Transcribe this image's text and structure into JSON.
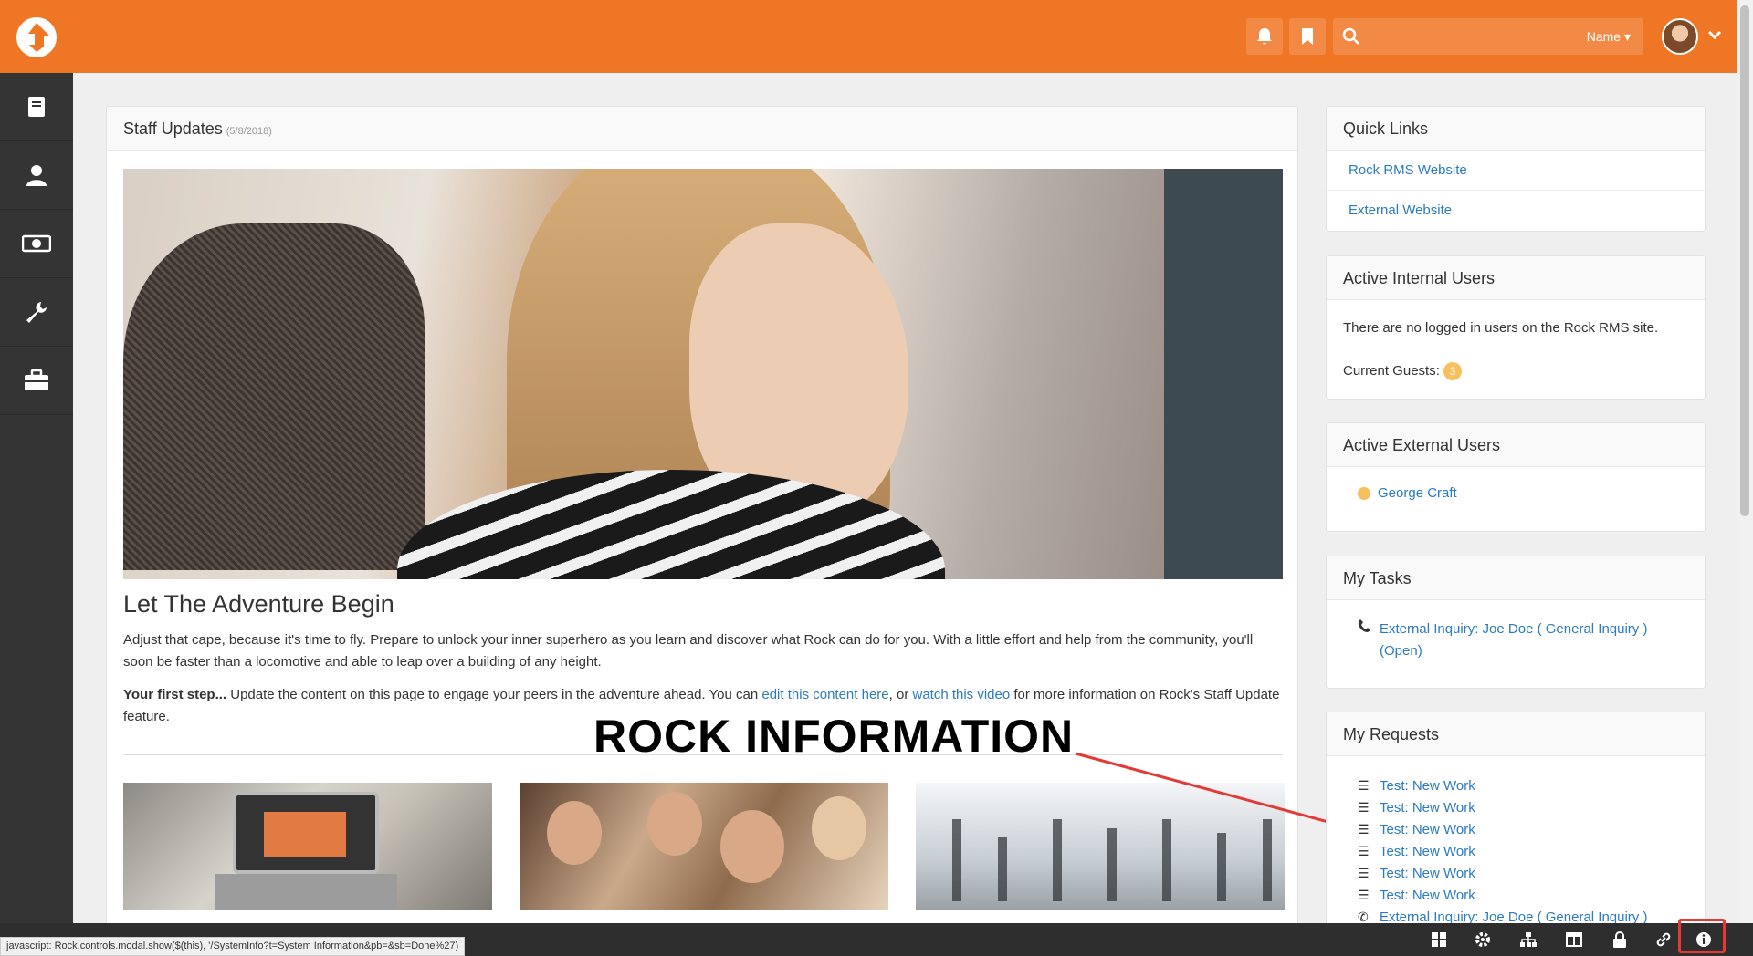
{
  "topbar": {
    "search_placeholder": "",
    "search_scope": "Name"
  },
  "main": {
    "panel_title": "Staff Updates",
    "panel_date": "(5/8/2018)",
    "headline": "Let The Adventure Begin",
    "intro": "Adjust that cape, because it's time to fly. Prepare to unlock your inner superhero as you learn and discover what Rock can do for you. With a little effort and help from the community, you'll soon be faster than a locomotive and able to leap over a building of any height.",
    "first_step_label": "Your first step...",
    "first_step_text1": " Update the content on this page to engage your peers in the adventure ahead. You can ",
    "first_step_link1": "edit this content here",
    "first_step_text2": ", or ",
    "first_step_link2": "watch this video",
    "first_step_text3": " for more information on Rock's Staff Update feature."
  },
  "annotation": "ROCK INFORMATION",
  "quick_links": {
    "title": "Quick Links",
    "items": [
      "Rock RMS Website",
      "External Website"
    ]
  },
  "internal_users": {
    "title": "Active Internal Users",
    "message": "There are no logged in users on the Rock RMS site.",
    "guests_label": "Current Guests:",
    "guests_count": "3"
  },
  "external_users": {
    "title": "Active External Users",
    "user": "George Craft"
  },
  "my_tasks": {
    "title": "My Tasks",
    "task": "External Inquiry: Joe Doe ( General Inquiry )",
    "task_status": "(Open)"
  },
  "my_requests": {
    "title": "My Requests",
    "items": [
      "Test: New Work",
      "Test: New Work",
      "Test: New Work",
      "Test: New Work",
      "Test: New Work",
      "Test: New Work"
    ],
    "last": "External Inquiry: Joe Doe ( General Inquiry )"
  },
  "statusbar": "javascript: Rock.controls.modal.show($(this), '/SystemInfo?t=System Information&pb=&sb=Done%27)",
  "colors": {
    "brand": "#ee7624",
    "sidebar": "#343434",
    "link": "#2b7bc0",
    "badge": "#f7c05e",
    "annotation_arrow": "#e53935"
  }
}
